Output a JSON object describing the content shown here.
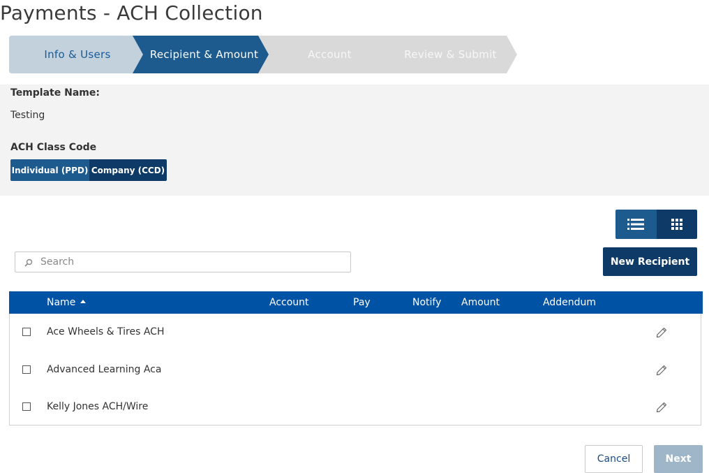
{
  "page": {
    "title": "Payments - ACH Collection"
  },
  "stepper": {
    "steps": [
      {
        "label": "Info & Users",
        "state": "completed"
      },
      {
        "label": "Recipient & Amount",
        "state": "current"
      },
      {
        "label": "Account",
        "state": "upcoming"
      },
      {
        "label": "Review & Submit",
        "state": "upcoming"
      }
    ]
  },
  "info": {
    "template_name_label": "Template Name:",
    "template_name_value": "Testing",
    "class_code_label": "ACH Class Code",
    "class_codes": [
      {
        "label": "Individual (PPD)",
        "selected": true
      },
      {
        "label": "Company (CCD)",
        "selected": false
      }
    ]
  },
  "view_toggle": {
    "options": [
      {
        "icon": "list-view-icon",
        "active": true
      },
      {
        "icon": "grid-view-icon",
        "active": false
      }
    ]
  },
  "search": {
    "placeholder": "Search",
    "value": "",
    "icon": "search-icon"
  },
  "new_recipient_label": "New Recipient",
  "table": {
    "columns": [
      "Name",
      "Account",
      "Pay",
      "Notify",
      "Amount",
      "Addendum"
    ],
    "sort": {
      "column": "Name",
      "direction": "ascending"
    },
    "rows": [
      {
        "name": "Ace Wheels & Tires ACH",
        "checked": false
      },
      {
        "name": "Advanced Learning Aca",
        "checked": false
      },
      {
        "name": "Kelly Jones ACH/Wire",
        "checked": false
      }
    ]
  },
  "footer": {
    "cancel_label": "Cancel",
    "next_label": "Next",
    "next_enabled": false
  },
  "colors": {
    "primary_dark": "#0d3a66",
    "primary": "#1d5a8e",
    "table_header": "#0052a5",
    "step_completed": "#c3d1dd",
    "step_upcoming": "#d9d9d9",
    "panel_bg": "#f3f3f3",
    "next_disabled": "#9fb6c9"
  }
}
